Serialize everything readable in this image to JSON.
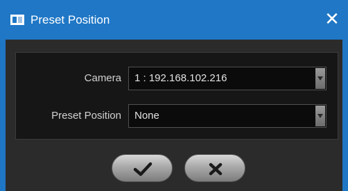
{
  "window": {
    "title": "Preset Position",
    "title_icon": "window-icon",
    "close_icon": "close-icon",
    "close_glyph": "✕"
  },
  "form": {
    "camera_label": "Camera",
    "camera_value": "1 : 192.168.102.216",
    "preset_label": "Preset Position",
    "preset_value": "None"
  },
  "buttons": {
    "ok_icon": "checkmark-icon",
    "cancel_icon": "x-icon"
  },
  "colors": {
    "title_bar": "#1f77c6",
    "panel": "#2b2b2b",
    "group_bg": "#161616"
  }
}
